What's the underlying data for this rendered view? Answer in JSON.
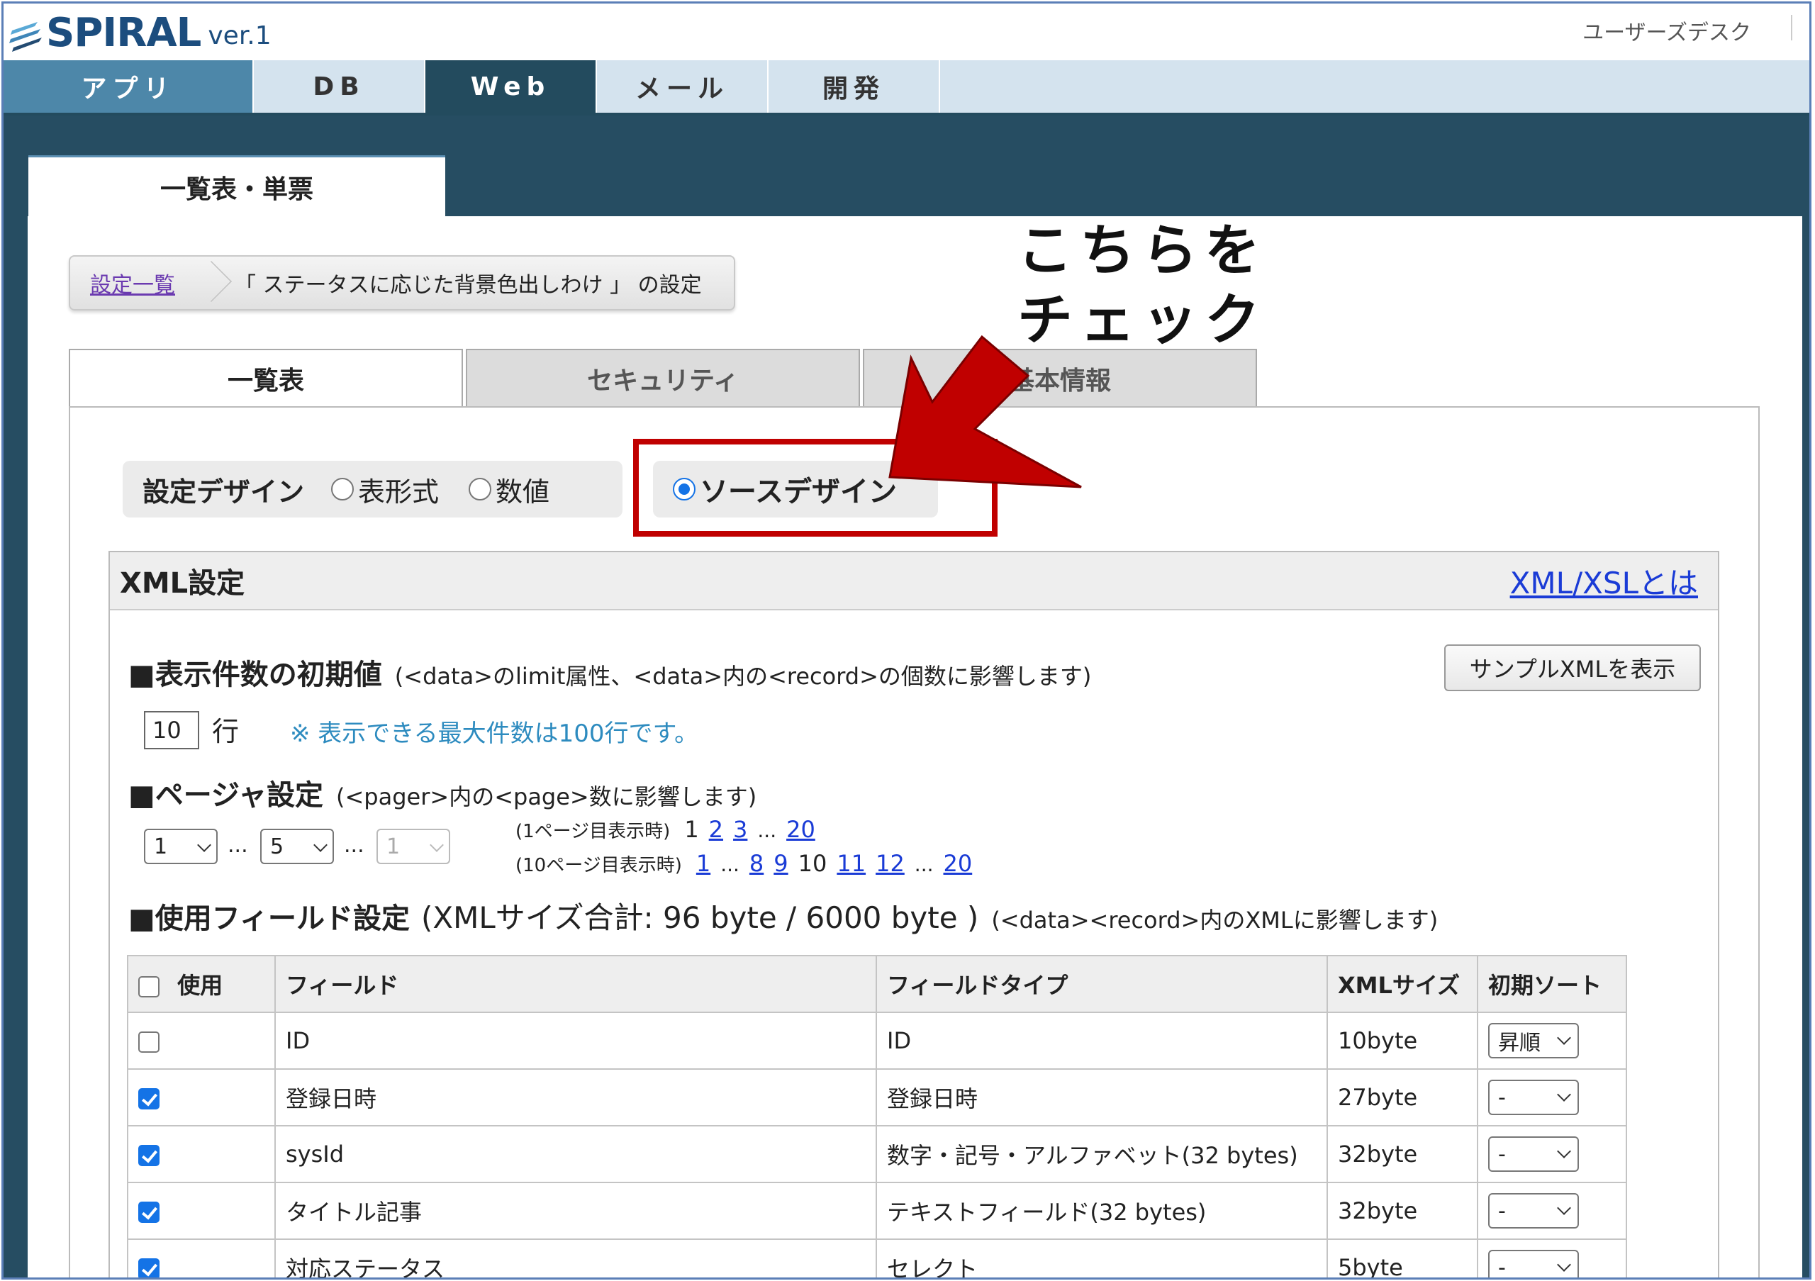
{
  "app": {
    "logo": "SPIRAL",
    "version": "ver.1",
    "user_desk": "ユーザーズデスク"
  },
  "nav": {
    "tabs": [
      "アプリ",
      "DB",
      "Web",
      "メール",
      "開発"
    ],
    "active": "Web"
  },
  "subtab": "一覧表・単票",
  "breadcrumb": {
    "link": "設定一覧",
    "current": "「 ステータスに応じた背景色出しわけ 」 の設定"
  },
  "content_tabs": [
    "一覧表",
    "セキュリティ",
    "基本情報"
  ],
  "annotation": {
    "line1": "こちらを",
    "line2": "チェック"
  },
  "design": {
    "label": "設定デザイン",
    "options": [
      "表形式",
      "数値",
      "ソースデザイン"
    ],
    "selected": "ソースデザイン"
  },
  "xml": {
    "title": "XML設定",
    "help_link": "XML/XSLとは",
    "sample_button": "サンプルXMLを表示",
    "limit": {
      "heading": "■表示件数の初期値",
      "note": "(<data>のlimit属性、<data>内の<record>の個数に影響します)",
      "value": "10",
      "unit": "行",
      "hint": "※ 表示できる最大件数は100行です。"
    },
    "pager": {
      "heading": "■ページャ設定",
      "note": "(<pager>内の<page>数に影響します)",
      "select1": "1",
      "select2": "5",
      "select3": "1",
      "ellipsis": "...",
      "line1_caption": "(1ページ目表示時)",
      "line1_current": "1",
      "line1_links": [
        "2",
        "3"
      ],
      "line1_last": "20",
      "line2_caption": "(10ページ目表示時)",
      "line2_first": "1",
      "line2_links_before": [
        "8",
        "9"
      ],
      "line2_current": "10",
      "line2_links_after": [
        "11",
        "12"
      ],
      "line2_last": "20"
    },
    "fields": {
      "heading": "■使用フィールド設定",
      "size_summary": "(XMLサイズ合計: 96 byte / 6000 byte )",
      "note": "(<data><record>内のXMLに影響します)",
      "columns": [
        "使用",
        "フィールド",
        "フィールドタイプ",
        "XMLサイズ",
        "初期ソート"
      ],
      "rows": [
        {
          "checked": false,
          "field": "ID",
          "type": "ID",
          "size": "10byte",
          "sort": "昇順"
        },
        {
          "checked": true,
          "field": "登録日時",
          "type": "登録日時",
          "size": "27byte",
          "sort": "-"
        },
        {
          "checked": true,
          "field": "sysId",
          "type": "数字・記号・アルファベット(32 bytes)",
          "size": "32byte",
          "sort": "-"
        },
        {
          "checked": true,
          "field": "タイトル記事",
          "type": "テキストフィールド(32 bytes)",
          "size": "32byte",
          "sort": "-"
        },
        {
          "checked": true,
          "field": "対応ステータス",
          "type": "セレクト",
          "size": "5byte",
          "sort": "-"
        }
      ]
    }
  },
  "colors": {
    "nav_active": "#234b5e",
    "nav_first": "#4d87a9",
    "highlight": "#c00000",
    "link": "#1a3bd6",
    "hint": "#2d8bbf"
  }
}
